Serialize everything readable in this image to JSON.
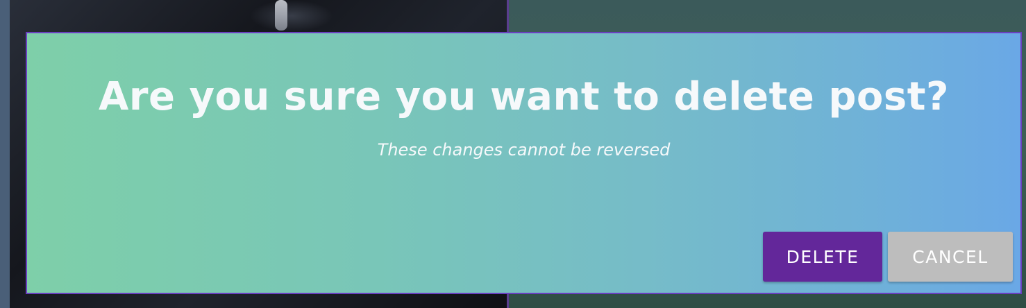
{
  "dialog": {
    "title": "Are you sure you want to delete post?",
    "subtitle": "These changes cannot be reversed",
    "delete_label": "DELETE",
    "cancel_label": "CANCEL"
  },
  "colors": {
    "gradient_start": "#7ecfa9",
    "gradient_end": "#6aa8e6",
    "dialog_border": "#6a3fc0",
    "delete_button": "#63279a",
    "cancel_button": "#bdbdbd",
    "text": "#f6f9fb"
  }
}
